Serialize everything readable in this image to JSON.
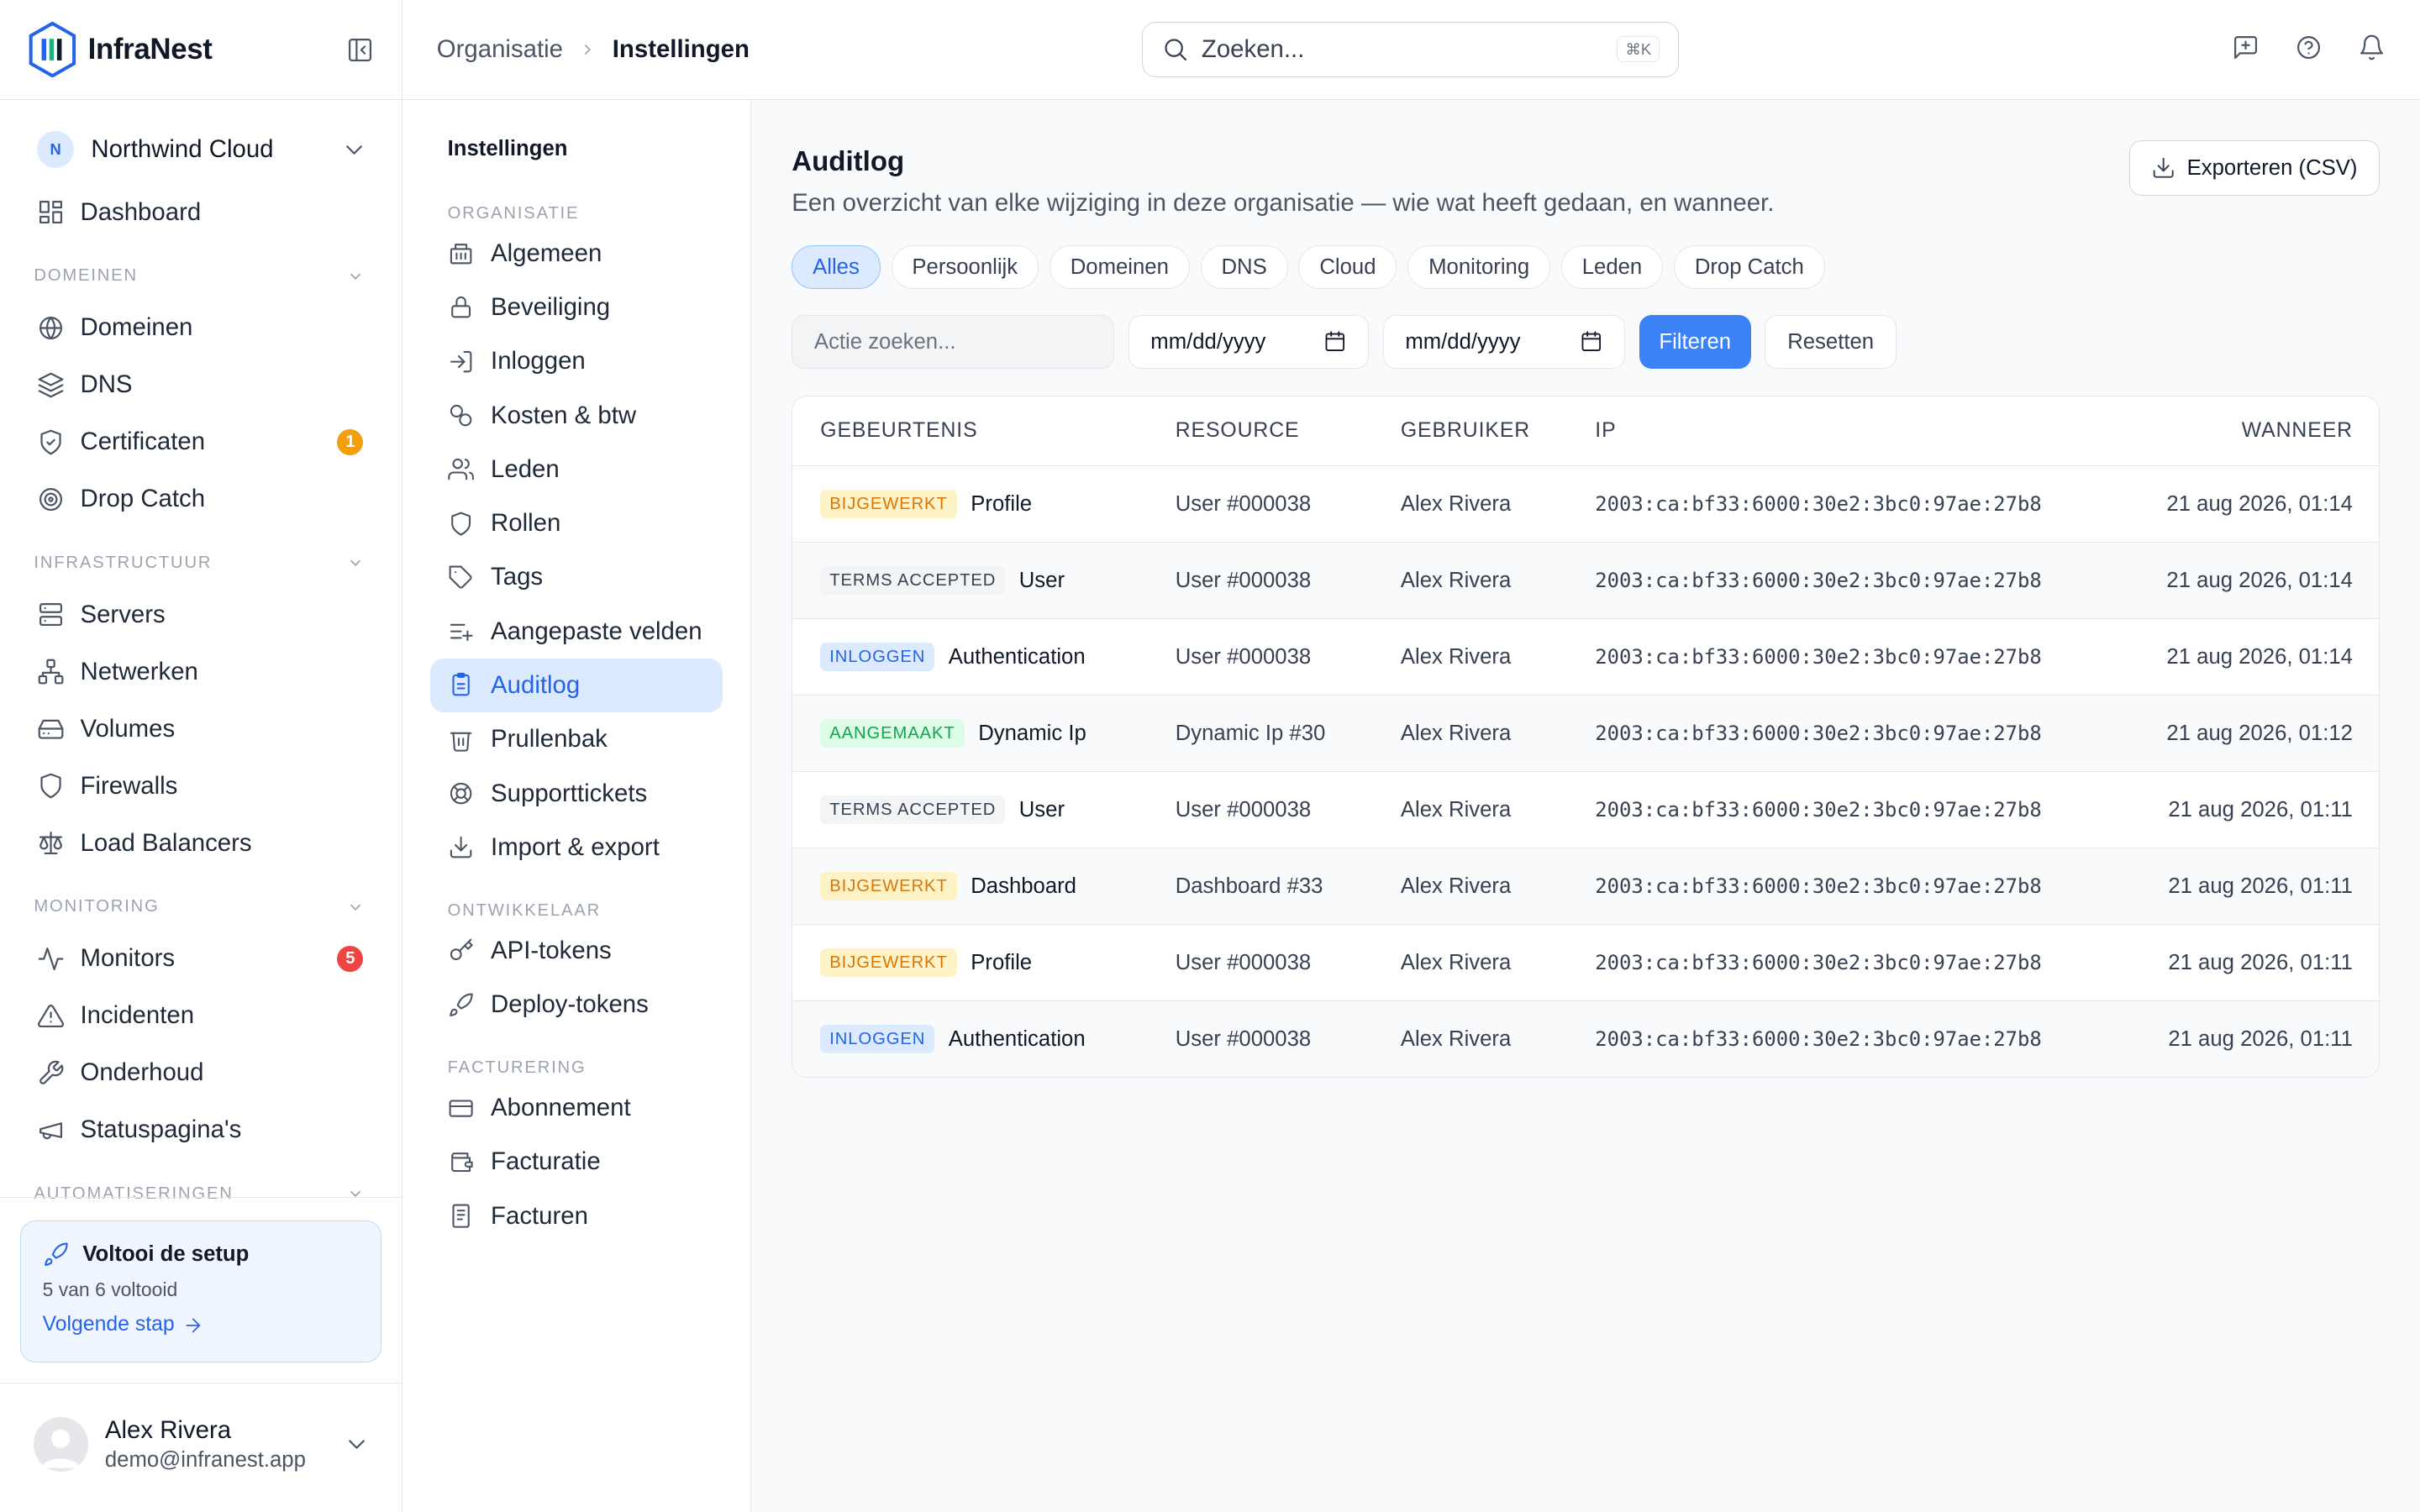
{
  "app": {
    "name": "InfraNest"
  },
  "org": {
    "initial": "N",
    "name": "Northwind Cloud"
  },
  "sidebar": {
    "dashboard": "Dashboard",
    "sections": [
      {
        "title": "DOMEINEN",
        "items": [
          {
            "label": "Domeinen",
            "icon": "globe-icon"
          },
          {
            "label": "DNS",
            "icon": "layers-icon"
          },
          {
            "label": "Certificaten",
            "icon": "shield-check-icon",
            "badge": "1",
            "badge_color": "#f59e0b"
          },
          {
            "label": "Drop Catch",
            "icon": "target-icon"
          }
        ]
      },
      {
        "title": "INFRASTRUCTUUR",
        "items": [
          {
            "label": "Servers",
            "icon": "server-icon"
          },
          {
            "label": "Netwerken",
            "icon": "network-icon"
          },
          {
            "label": "Volumes",
            "icon": "hard-drive-icon"
          },
          {
            "label": "Firewalls",
            "icon": "shield-icon"
          },
          {
            "label": "Load Balancers",
            "icon": "scale-icon"
          }
        ]
      },
      {
        "title": "MONITORING",
        "items": [
          {
            "label": "Monitors",
            "icon": "activity-icon",
            "badge": "5",
            "badge_color": "#ef4444"
          },
          {
            "label": "Incidenten",
            "icon": "alert-triangle-icon"
          },
          {
            "label": "Onderhoud",
            "icon": "wrench-icon"
          },
          {
            "label": "Statuspagina's",
            "icon": "megaphone-icon"
          }
        ]
      },
      {
        "title": "AUTOMATISERINGEN",
        "items": []
      }
    ],
    "setup": {
      "title": "Voltooi de setup",
      "progress": "5 van 6 voltooid",
      "link": "Volgende stap"
    },
    "user": {
      "name": "Alex Rivera",
      "email": "demo@infranest.app"
    }
  },
  "topbar": {
    "breadcrumb": [
      "Organisatie",
      "Instellingen"
    ],
    "search_placeholder": "Zoeken...",
    "search_shortcut": "⌘K"
  },
  "subnav": {
    "title": "Instellingen",
    "sections": [
      {
        "title": "ORGANISATIE",
        "items": [
          "Algemeen",
          "Beveiliging",
          "Inloggen",
          "Kosten & btw",
          "Leden",
          "Rollen",
          "Tags",
          "Aangepaste velden",
          "Auditlog",
          "Prullenbak",
          "Supporttickets",
          "Import & export"
        ]
      },
      {
        "title": "ONTWIKKELAAR",
        "items": [
          "API-tokens",
          "Deploy-tokens"
        ]
      },
      {
        "title": "FACTURERING",
        "items": [
          "Abonnement",
          "Facturatie",
          "Facturen"
        ]
      }
    ],
    "active": "Auditlog"
  },
  "main": {
    "title": "Auditlog",
    "description": "Een overzicht van elke wijziging in deze organisatie — wie wat heeft gedaan, en wanneer.",
    "export_label": "Exporteren (CSV)",
    "chips": [
      "Alles",
      "Persoonlijk",
      "Domeinen",
      "DNS",
      "Cloud",
      "Monitoring",
      "Leden",
      "Drop Catch"
    ],
    "active_chip": "Alles",
    "filters": {
      "search_placeholder": "Actie zoeken...",
      "date_from": "mm/dd/yyyy",
      "date_to": "mm/dd/yyyy",
      "filter_label": "Filteren",
      "reset_label": "Resetten"
    },
    "table": {
      "columns": [
        "GEBEURTENIS",
        "RESOURCE",
        "GEBRUIKER",
        "IP",
        "WANNEER"
      ],
      "rows": [
        {
          "tag": "BIJGEWERKT",
          "tag_type": "upd",
          "event": "Profile",
          "resource": "User #000038",
          "user": "Alex Rivera",
          "ip": "2003:ca:bf33:6000:30e2:3bc0:97ae:27b8",
          "when": "21 aug 2026, 01:14"
        },
        {
          "tag": "TERMS ACCEPTED",
          "tag_type": "terms",
          "event": "User",
          "resource": "User #000038",
          "user": "Alex Rivera",
          "ip": "2003:ca:bf33:6000:30e2:3bc0:97ae:27b8",
          "when": "21 aug 2026, 01:14"
        },
        {
          "tag": "INLOGGEN",
          "tag_type": "login",
          "event": "Authentication",
          "resource": "User #000038",
          "user": "Alex Rivera",
          "ip": "2003:ca:bf33:6000:30e2:3bc0:97ae:27b8",
          "when": "21 aug 2026, 01:14"
        },
        {
          "tag": "AANGEMAAKT",
          "tag_type": "made",
          "event": "Dynamic Ip",
          "resource": "Dynamic Ip #30",
          "user": "Alex Rivera",
          "ip": "2003:ca:bf33:6000:30e2:3bc0:97ae:27b8",
          "when": "21 aug 2026, 01:12"
        },
        {
          "tag": "TERMS ACCEPTED",
          "tag_type": "terms",
          "event": "User",
          "resource": "User #000038",
          "user": "Alex Rivera",
          "ip": "2003:ca:bf33:6000:30e2:3bc0:97ae:27b8",
          "when": "21 aug 2026, 01:11"
        },
        {
          "tag": "BIJGEWERKT",
          "tag_type": "upd",
          "event": "Dashboard",
          "resource": "Dashboard #33",
          "user": "Alex Rivera",
          "ip": "2003:ca:bf33:6000:30e2:3bc0:97ae:27b8",
          "when": "21 aug 2026, 01:11"
        },
        {
          "tag": "BIJGEWERKT",
          "tag_type": "upd",
          "event": "Profile",
          "resource": "User #000038",
          "user": "Alex Rivera",
          "ip": "2003:ca:bf33:6000:30e2:3bc0:97ae:27b8",
          "when": "21 aug 2026, 01:11"
        },
        {
          "tag": "INLOGGEN",
          "tag_type": "login",
          "event": "Authentication",
          "resource": "User #000038",
          "user": "Alex Rivera",
          "ip": "2003:ca:bf33:6000:30e2:3bc0:97ae:27b8",
          "when": "21 aug 2026, 01:11"
        }
      ]
    }
  }
}
